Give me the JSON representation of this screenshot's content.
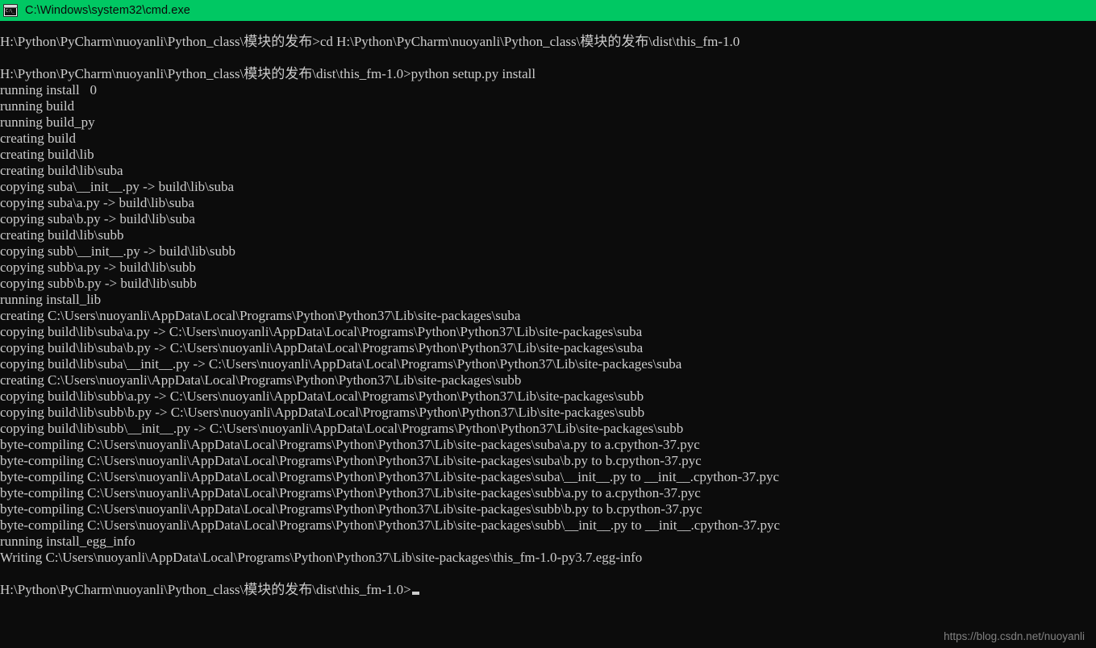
{
  "window": {
    "title": "C:\\Windows\\system32\\cmd.exe",
    "icon": "cmd-console-icon",
    "icon_glyph": "C:\\_",
    "titlebar_color": "#00c863",
    "background_color": "#0c0c0c",
    "text_color": "#cccccc"
  },
  "console": {
    "prompt_cwd_1": "H:\\Python\\PyCharm\\nuoyanli\\Python_class\\模块的发布",
    "prompt_cwd_2": "H:\\Python\\PyCharm\\nuoyanli\\Python_class\\模块的发布\\dist\\this_fm-1.0",
    "command_1": "cd H:\\Python\\PyCharm\\nuoyanli\\Python_class\\模块的发布\\dist\\this_fm-1.0",
    "command_2": "python setup.py install",
    "cursor": "block-underscore-cursor",
    "lines": [
      "H:\\Python\\PyCharm\\nuoyanli\\Python_class\\模块的发布>cd H:\\Python\\PyCharm\\nuoyanli\\Python_class\\模块的发布\\dist\\this_fm-1.0",
      "",
      "H:\\Python\\PyCharm\\nuoyanli\\Python_class\\模块的发布\\dist\\this_fm-1.0>python setup.py install",
      "running install   0",
      "running build",
      "running build_py",
      "creating build",
      "creating build\\lib",
      "creating build\\lib\\suba",
      "copying suba\\__init__.py -> build\\lib\\suba",
      "copying suba\\a.py -> build\\lib\\suba",
      "copying suba\\b.py -> build\\lib\\suba",
      "creating build\\lib\\subb",
      "copying subb\\__init__.py -> build\\lib\\subb",
      "copying subb\\a.py -> build\\lib\\subb",
      "copying subb\\b.py -> build\\lib\\subb",
      "running install_lib",
      "creating C:\\Users\\nuoyanli\\AppData\\Local\\Programs\\Python\\Python37\\Lib\\site-packages\\suba",
      "copying build\\lib\\suba\\a.py -> C:\\Users\\nuoyanli\\AppData\\Local\\Programs\\Python\\Python37\\Lib\\site-packages\\suba",
      "copying build\\lib\\suba\\b.py -> C:\\Users\\nuoyanli\\AppData\\Local\\Programs\\Python\\Python37\\Lib\\site-packages\\suba",
      "copying build\\lib\\suba\\__init__.py -> C:\\Users\\nuoyanli\\AppData\\Local\\Programs\\Python\\Python37\\Lib\\site-packages\\suba",
      "creating C:\\Users\\nuoyanli\\AppData\\Local\\Programs\\Python\\Python37\\Lib\\site-packages\\subb",
      "copying build\\lib\\subb\\a.py -> C:\\Users\\nuoyanli\\AppData\\Local\\Programs\\Python\\Python37\\Lib\\site-packages\\subb",
      "copying build\\lib\\subb\\b.py -> C:\\Users\\nuoyanli\\AppData\\Local\\Programs\\Python\\Python37\\Lib\\site-packages\\subb",
      "copying build\\lib\\subb\\__init__.py -> C:\\Users\\nuoyanli\\AppData\\Local\\Programs\\Python\\Python37\\Lib\\site-packages\\subb",
      "byte-compiling C:\\Users\\nuoyanli\\AppData\\Local\\Programs\\Python\\Python37\\Lib\\site-packages\\suba\\a.py to a.cpython-37.pyc",
      "byte-compiling C:\\Users\\nuoyanli\\AppData\\Local\\Programs\\Python\\Python37\\Lib\\site-packages\\suba\\b.py to b.cpython-37.pyc",
      "byte-compiling C:\\Users\\nuoyanli\\AppData\\Local\\Programs\\Python\\Python37\\Lib\\site-packages\\suba\\__init__.py to __init__.cpython-37.pyc",
      "byte-compiling C:\\Users\\nuoyanli\\AppData\\Local\\Programs\\Python\\Python37\\Lib\\site-packages\\subb\\a.py to a.cpython-37.pyc",
      "byte-compiling C:\\Users\\nuoyanli\\AppData\\Local\\Programs\\Python\\Python37\\Lib\\site-packages\\subb\\b.py to b.cpython-37.pyc",
      "byte-compiling C:\\Users\\nuoyanli\\AppData\\Local\\Programs\\Python\\Python37\\Lib\\site-packages\\subb\\__init__.py to __init__.cpython-37.pyc",
      "running install_egg_info",
      "Writing C:\\Users\\nuoyanli\\AppData\\Local\\Programs\\Python\\Python37\\Lib\\site-packages\\this_fm-1.0-py3.7.egg-info",
      "",
      "H:\\Python\\PyCharm\\nuoyanli\\Python_class\\模块的发布\\dist\\this_fm-1.0>"
    ]
  },
  "watermark": {
    "text": "https://blog.csdn.net/nuoyanli"
  }
}
